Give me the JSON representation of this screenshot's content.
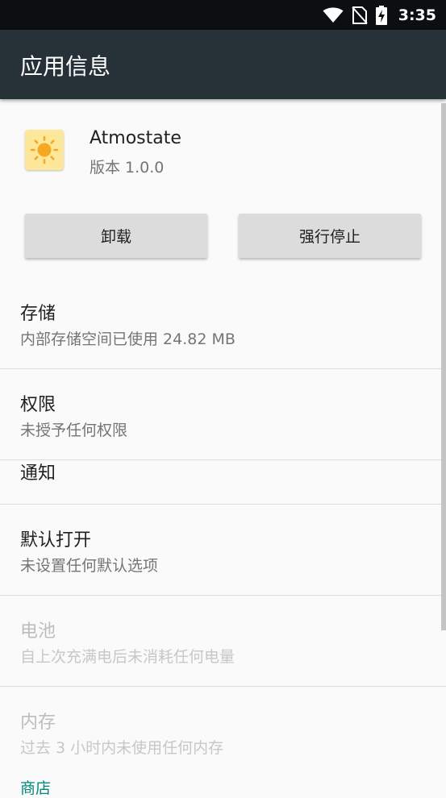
{
  "status_bar": {
    "time": "3:35",
    "icons": [
      "wifi-icon",
      "no-sim-icon",
      "battery-charging-icon"
    ]
  },
  "app_bar": {
    "title": "应用信息"
  },
  "app": {
    "name": "Atmostate",
    "version": "版本 1.0.0",
    "icon": "sun-icon"
  },
  "buttons": {
    "uninstall": "卸载",
    "force_stop": "强行停止"
  },
  "sections": {
    "storage": {
      "title": "存储",
      "subtitle": "内部存储空间已使用 24.82 MB"
    },
    "permissions": {
      "title": "权限",
      "subtitle": "未授予任何权限"
    },
    "notifications": {
      "title": "通知"
    },
    "open_by_default": {
      "title": "默认打开",
      "subtitle": "未设置任何默认选项"
    },
    "battery": {
      "title": "电池",
      "subtitle": "自上次充满电后未消耗任何电量"
    },
    "memory": {
      "title": "内存",
      "subtitle": "过去 3 小时内未使用任何内存"
    },
    "store": {
      "title": "商店"
    }
  },
  "colors": {
    "app_bar": "#263238",
    "status_bar": "#0b0f12",
    "background": "#fafafa",
    "accent": "#00897b",
    "button": "#dcdcdc"
  }
}
